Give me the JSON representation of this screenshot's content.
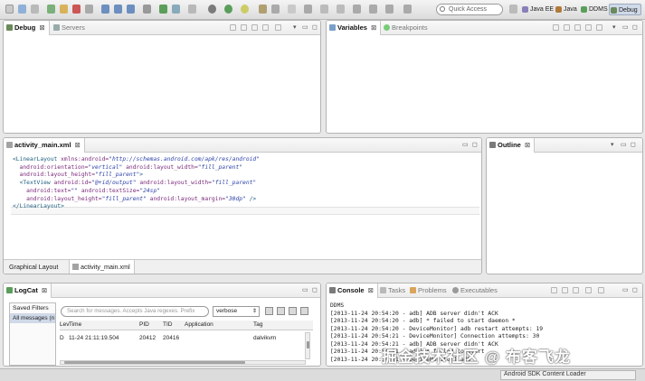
{
  "toolbar": {
    "quick_access_placeholder": "Quick Access",
    "perspectives": [
      {
        "label": "Java EE",
        "icon": "java-ee-icon"
      },
      {
        "label": "Java",
        "icon": "java-icon"
      },
      {
        "label": "DDMS",
        "icon": "ddms-icon"
      },
      {
        "label": "Debug",
        "icon": "debug-icon",
        "active": true
      }
    ]
  },
  "debug_view": {
    "tabs": [
      {
        "label": "Debug",
        "active": true
      },
      {
        "label": "Servers",
        "active": false
      }
    ]
  },
  "variables_view": {
    "tabs": [
      {
        "label": "Variables",
        "active": true
      },
      {
        "label": "Breakpoints",
        "active": false
      }
    ]
  },
  "editor": {
    "tab_label": "activity_main.xml",
    "bottom_tabs": [
      "Graphical Layout",
      "activity_main.xml"
    ],
    "xml": {
      "l1_tag": "<LinearLayout",
      "l1_attr": "xmlns:android=",
      "l1_str": "\"http://schemas.android.com/apk/res/android\"",
      "l2_attr1": "android:orientation=",
      "l2_str1": "\"vertical\"",
      "l2_attr2": "android:layout_width=",
      "l2_str2": "\"fill_parent\"",
      "l3_attr": "android:layout_height=",
      "l3_str": "\"fill_parent\"",
      "l3_tag": ">",
      "l4_tag": "<TextView",
      "l4_attr1": "android:id=",
      "l4_str1": "\"@+id/output\"",
      "l4_attr2": "android:layout_width=",
      "l4_str2": "\"fill_parent\"",
      "l5_attr1": "android:text=",
      "l5_str1": "\"\"",
      "l5_attr2": "android:textSize=",
      "l5_str2": "\"24sp\"",
      "l6_attr1": "android:layout_height=",
      "l6_str1": "\"fill_parent\"",
      "l6_attr2": "android:layout_margin=",
      "l6_str2": "\"30dp\"",
      "l6_tag": "/>",
      "l7_tag": "</LinearLayout>"
    }
  },
  "outline_view": {
    "tab_label": "Outline"
  },
  "logcat": {
    "tab_label": "LogCat",
    "saved_filters_header": "Saved Filters",
    "saved_filters_selected": "All messages (n",
    "search_placeholder": "Search for messages. Accepts Java regexes. Prefix",
    "verbosity": "verbose",
    "columns": [
      "Lev",
      "Time",
      "PID",
      "TID",
      "Application",
      "Tag"
    ],
    "rows": [
      {
        "level": "D",
        "time": "11-24 21:11:19.504",
        "pid": "20412",
        "tid": "20416",
        "application": "",
        "tag": "dalvikvm"
      }
    ]
  },
  "console": {
    "tabs": [
      "Console",
      "Tasks",
      "Problems",
      "Executables"
    ],
    "title": "DDMS",
    "lines": [
      "[2013-11-24 20:54:20 - adb] ADB server didn't ACK",
      "[2013-11-24 20:54:20 - adb] * failed to start daemon *",
      "[2013-11-24 20:54:20 - DeviceMonitor] adb restart attempts: 19",
      "[2013-11-24 20:54:21 - DeviceMonitor] Connection attempts: 30",
      "[2013-11-24 20:54:21 - adb] ADB server didn't ACK",
      "[2013-11-24 20:54:21 - adb] * failed to start",
      "[2013-11-24 20:54:21 - DeviceMonitor] adb"
    ]
  },
  "status": {
    "task": "Android SDK Content Loader"
  },
  "watermark": "掘金技术社区 @ 布客飞龙"
}
